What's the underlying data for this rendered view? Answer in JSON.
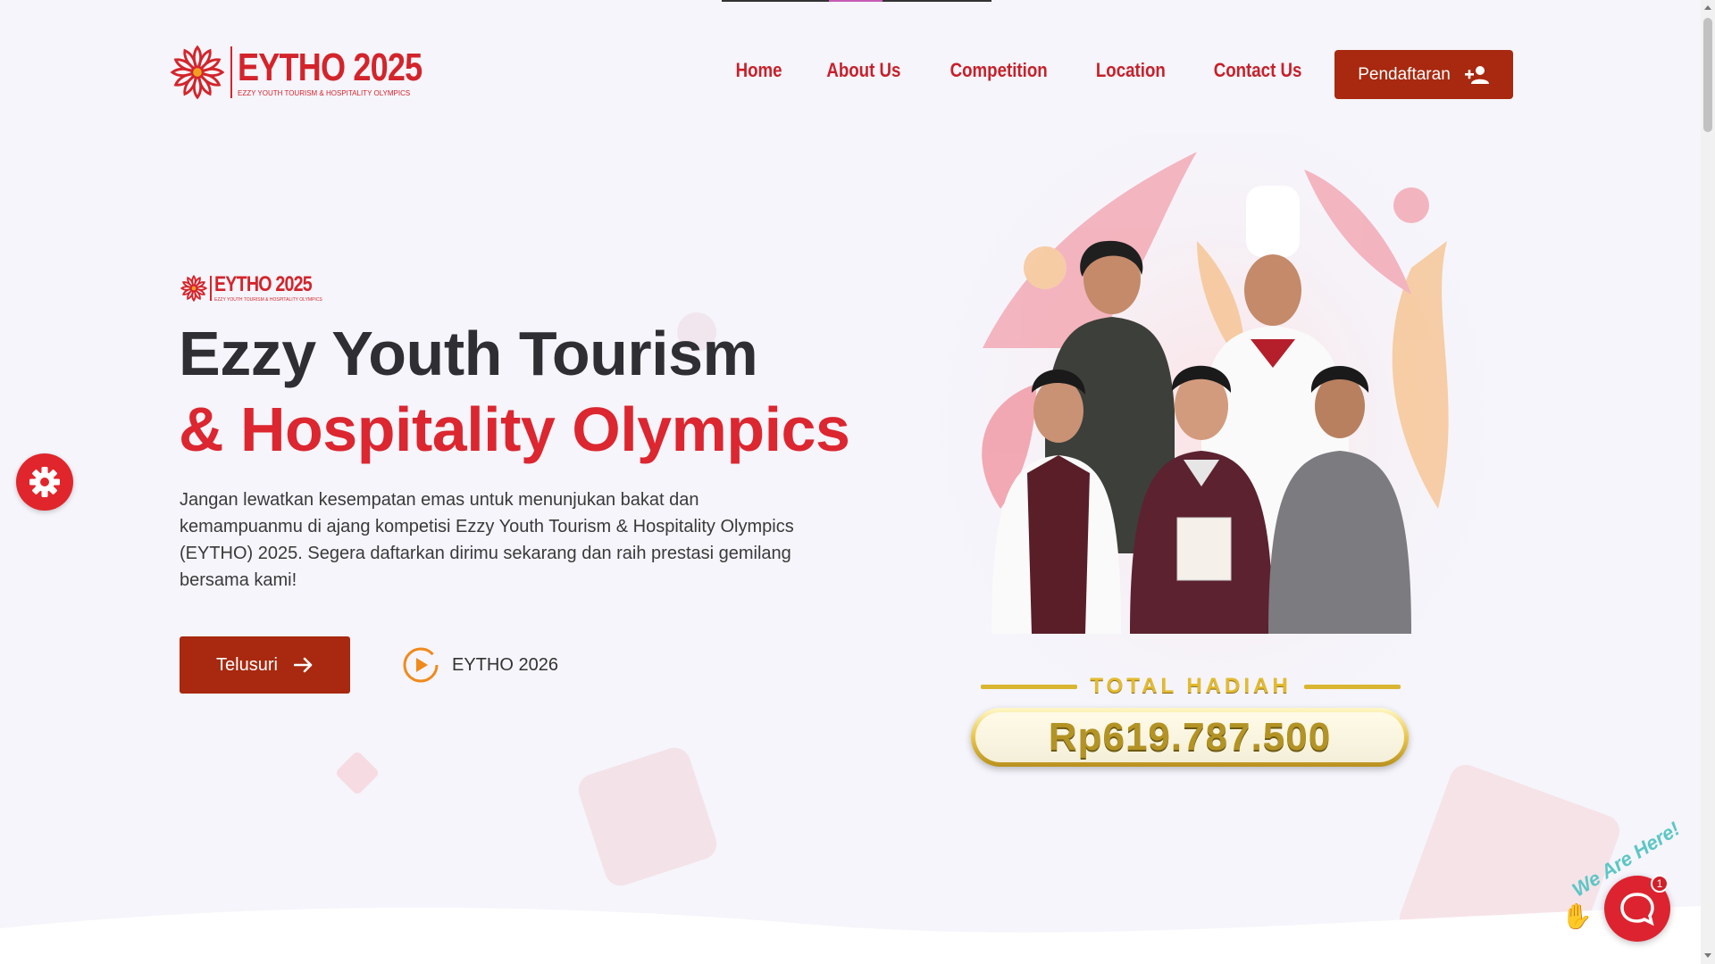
{
  "header": {
    "logo_title": "EYTHO 2025",
    "logo_subtitle": "EZZY YOUTH TOURISM & HOSPITALITY OLYMPICS",
    "nav": [
      "Home",
      "About Us",
      "Competition",
      "Location",
      "Contact Us"
    ],
    "register_label": "Pendaftaran"
  },
  "hero": {
    "small_logo_title": "EYTHO 2025",
    "small_logo_subtitle": "EZZY YOUTH TOURISM & HOSPITALITY OLYMPICS",
    "title_line1": "Ezzy Youth Tourism",
    "title_line2": "& Hospitality Olympics",
    "description": "Jangan lewatkan kesempatan emas untuk menunjukan bakat dan kemampuanmu di ajang kompetisi Ezzy Youth Tourism & Hospitality Olympics (EYTHO) 2025. Segera daftarkan dirimu sekarang dan raih prestasi gemilang bersama kami!",
    "cta_label": "Telusuri",
    "video_label": "EYTHO 2026"
  },
  "prize": {
    "label": "TOTAL HADIAH",
    "amount": "Rp619.787.500"
  },
  "chat": {
    "tagline": "We Are Here!",
    "badge_count": "1"
  },
  "colors": {
    "brand_red": "#d4242b",
    "button_red": "#a8290f",
    "gold": "#e2bb2f"
  }
}
